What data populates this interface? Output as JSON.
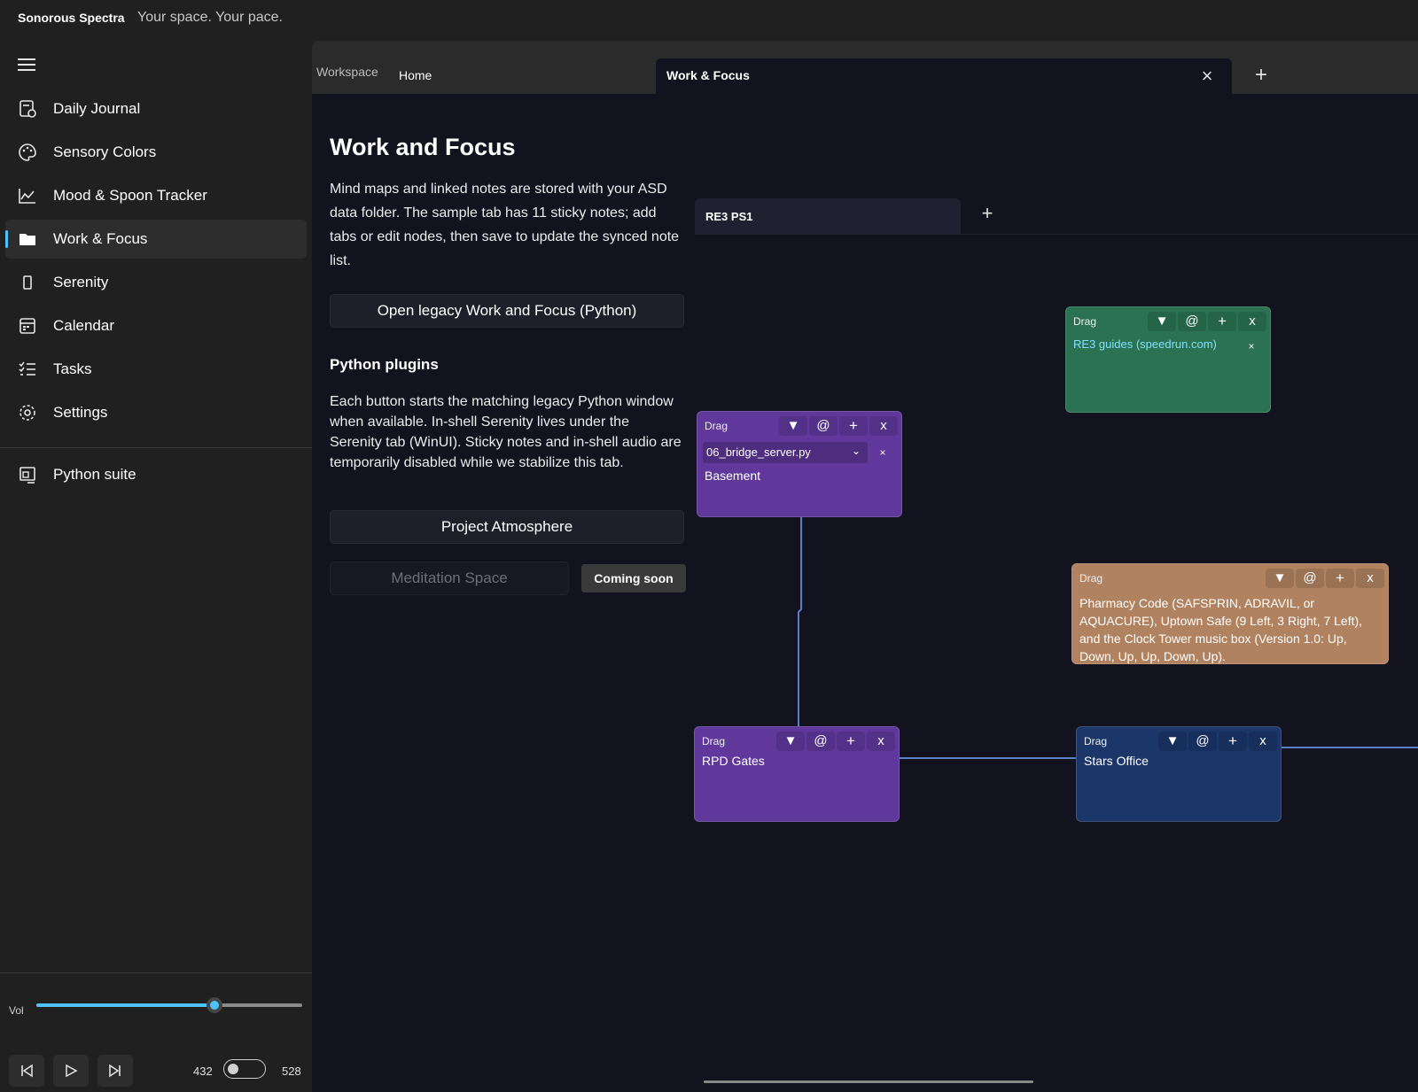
{
  "app": {
    "name": "Sonorous Spectra",
    "tagline": "Your space. Your pace."
  },
  "sidebar": {
    "items": [
      {
        "label": "Daily Journal",
        "icon": "journal-icon"
      },
      {
        "label": "Sensory Colors",
        "icon": "palette-icon"
      },
      {
        "label": "Mood & Spoon Tracker",
        "icon": "chart-icon"
      },
      {
        "label": "Work & Focus",
        "icon": "folder-icon",
        "active": true
      },
      {
        "label": "Serenity",
        "icon": "phone-icon"
      },
      {
        "label": "Calendar",
        "icon": "calendar-icon"
      },
      {
        "label": "Tasks",
        "icon": "tasks-icon"
      },
      {
        "label": "Settings",
        "icon": "gear-icon"
      }
    ],
    "footer_items": [
      {
        "label": "Python suite",
        "icon": "python-suite-icon"
      }
    ],
    "volume": {
      "label": "Vol",
      "level": 0.67
    },
    "frequencies": {
      "left": "432",
      "right": "528",
      "toggle_on": false
    },
    "accent_color": "#4cc2ff"
  },
  "tabs": {
    "group_label": "Workspace",
    "items": [
      {
        "label": "Home"
      },
      {
        "label": "Work & Focus",
        "active": true
      }
    ]
  },
  "page": {
    "title": "Work and Focus",
    "description": "Mind maps and linked notes are stored with your ASD data folder. The sample tab has 11 sticky notes; add tabs or edit nodes, then save to update the synced note list.",
    "legacy_button": "Open legacy Work and Focus (Python)",
    "plugins_heading": "Python plugins",
    "plugins_description": "Each button starts the matching legacy Python window when available. In-shell Serenity lives under the Serenity tab (WinUI). Sticky notes and in-shell audio are temporarily disabled while we stabilize this tab.",
    "plugin_buttons": [
      {
        "label": "Project Atmosphere"
      }
    ],
    "meditation_button": "Meditation Space",
    "coming_soon": "Coming soon"
  },
  "mindmap": {
    "tab_label": "RE3 PS1",
    "note_tools": {
      "drag": "Drag",
      "collapse": "▼",
      "link": "@",
      "add": "+",
      "close": "x"
    },
    "notes": {
      "basement": {
        "file": "06_bridge_server.py",
        "text": "Basement",
        "color": "#60389b"
      },
      "guides": {
        "link": "RE3 guides (speedrun.com)",
        "color": "#2a7251"
      },
      "codes": {
        "text": "Pharmacy Code (SAFSPRIN, ADRAVIL, or AQUACURE), Uptown Safe (9 Left, 3 Right, 7 Left), and the Clock Tower music box (Version 1.0: Up, Down, Up, Up, Down, Up).",
        "color": "#b08260"
      },
      "gates": {
        "text": "RPD Gates",
        "color": "#60389b"
      },
      "stars": {
        "text": "Stars Office",
        "color": "#1b3669"
      }
    },
    "connector_color": "#5b7fc6"
  }
}
